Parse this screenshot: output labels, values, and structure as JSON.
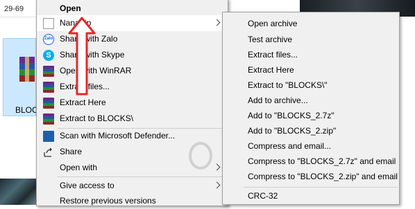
{
  "explorer": {
    "path_fragment": "29-69",
    "file_label": "BLOCK"
  },
  "main_menu": {
    "items": [
      {
        "label": "Open",
        "icon": "none",
        "bold": true
      },
      {
        "label": "NanaZip",
        "icon": "nanazip-icon",
        "has_submenu": true,
        "highlighted": true
      },
      {
        "label": "Share with Zalo",
        "icon": "zalo-icon"
      },
      {
        "label": "Share with Skype",
        "icon": "skype-icon"
      },
      {
        "label": "Open with WinRAR",
        "icon": "winrar-icon"
      },
      {
        "label": "Extract files...",
        "icon": "winrar-icon"
      },
      {
        "label": "Extract Here",
        "icon": "winrar-icon"
      },
      {
        "label": "Extract to BLOCKS\\",
        "icon": "winrar-icon"
      },
      {
        "label": "Scan with Microsoft Defender...",
        "icon": "defender-icon"
      },
      {
        "label": "Share",
        "icon": "share-icon"
      },
      {
        "label": "Open with",
        "icon": "none",
        "has_submenu": true
      },
      {
        "label": "Give access to",
        "icon": "none",
        "has_submenu": true
      },
      {
        "label": "Restore previous versions",
        "icon": "none"
      }
    ]
  },
  "sub_menu": {
    "items": [
      {
        "label": "Open archive"
      },
      {
        "label": "Test archive"
      },
      {
        "label": "Extract files..."
      },
      {
        "label": "Extract Here"
      },
      {
        "label": "Extract to \"BLOCKS\\\""
      },
      {
        "label": "Add to archive..."
      },
      {
        "label": "Add to \"BLOCKS_2.7z\""
      },
      {
        "label": "Add to \"BLOCKS_2.zip\""
      },
      {
        "label": "Compress and email..."
      },
      {
        "label": "Compress to \"BLOCKS_2.7z\" and email"
      },
      {
        "label": "Compress to \"BLOCKS_2.zip\" and email"
      },
      {
        "label": "CRC-32"
      }
    ]
  },
  "colors": {
    "menu_bg": "#f0f0f0",
    "highlight": "#ffffff",
    "selection": "#cce8ff",
    "annotation_arrow": "#e8262b"
  }
}
